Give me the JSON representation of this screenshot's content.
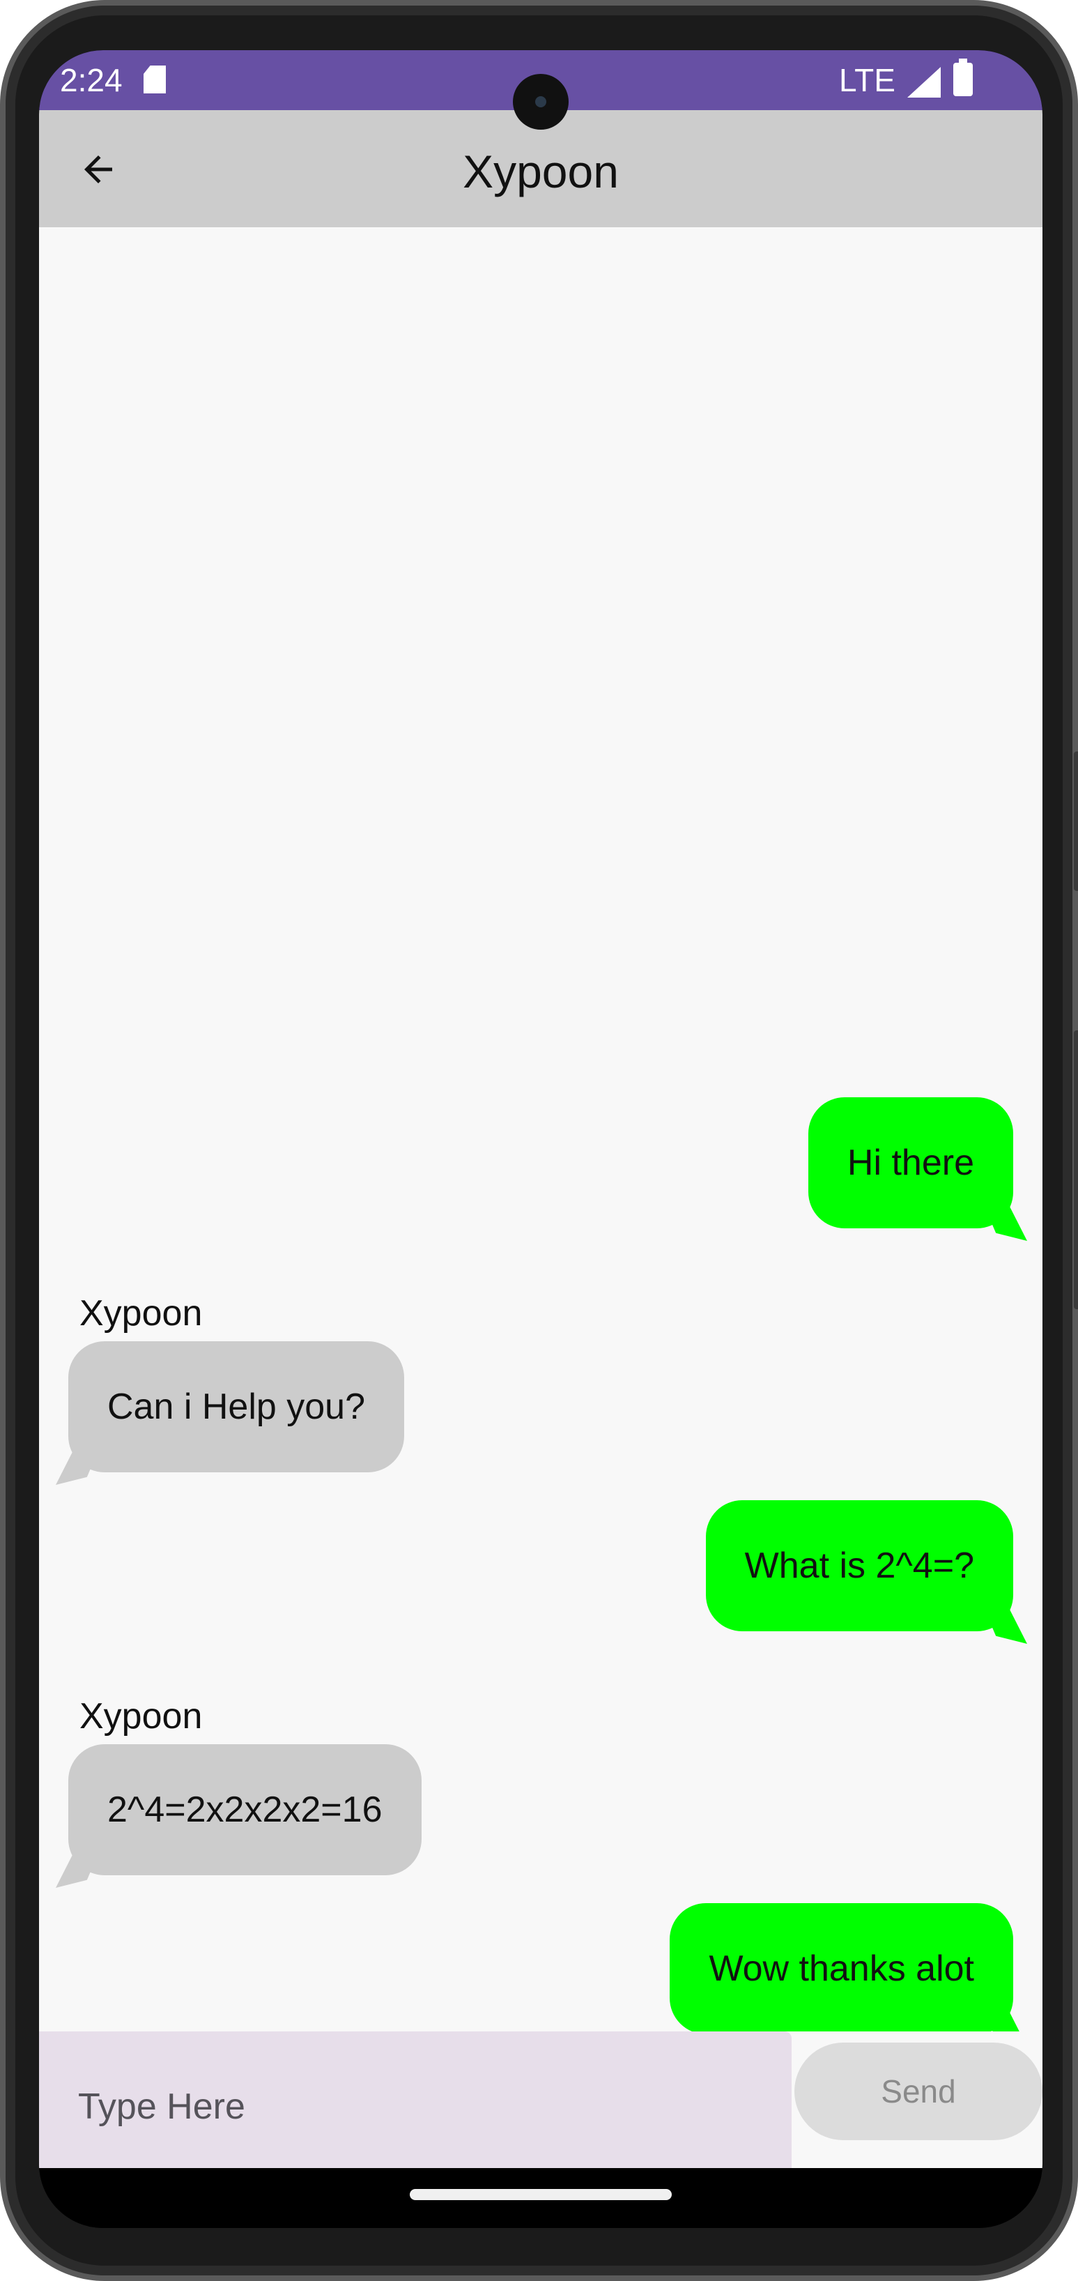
{
  "status_bar": {
    "time": "2:24",
    "network": "LTE",
    "icons": [
      "sd-card-icon",
      "signal-icon",
      "battery-icon"
    ]
  },
  "app_bar": {
    "back_icon": "arrow-left-icon",
    "title": "Xypoon"
  },
  "messages": [
    {
      "direction": "out",
      "text": "Hi there"
    },
    {
      "direction": "in",
      "sender": "Xypoon",
      "text": "Can i Help you?"
    },
    {
      "direction": "out",
      "text": "What is 2^4=?"
    },
    {
      "direction": "in",
      "sender": "Xypoon",
      "text": "2^4=2x2x2x2=16"
    },
    {
      "direction": "out",
      "text": "Wow thanks alot"
    }
  ],
  "composer": {
    "placeholder": "Type Here",
    "send_label": "Send"
  },
  "colors": {
    "status_bar": "#6750a4",
    "app_bar": "#cccccc",
    "outgoing_bubble": "#00ff00",
    "incoming_bubble": "#cccccc",
    "input_background": "#e7deea"
  }
}
